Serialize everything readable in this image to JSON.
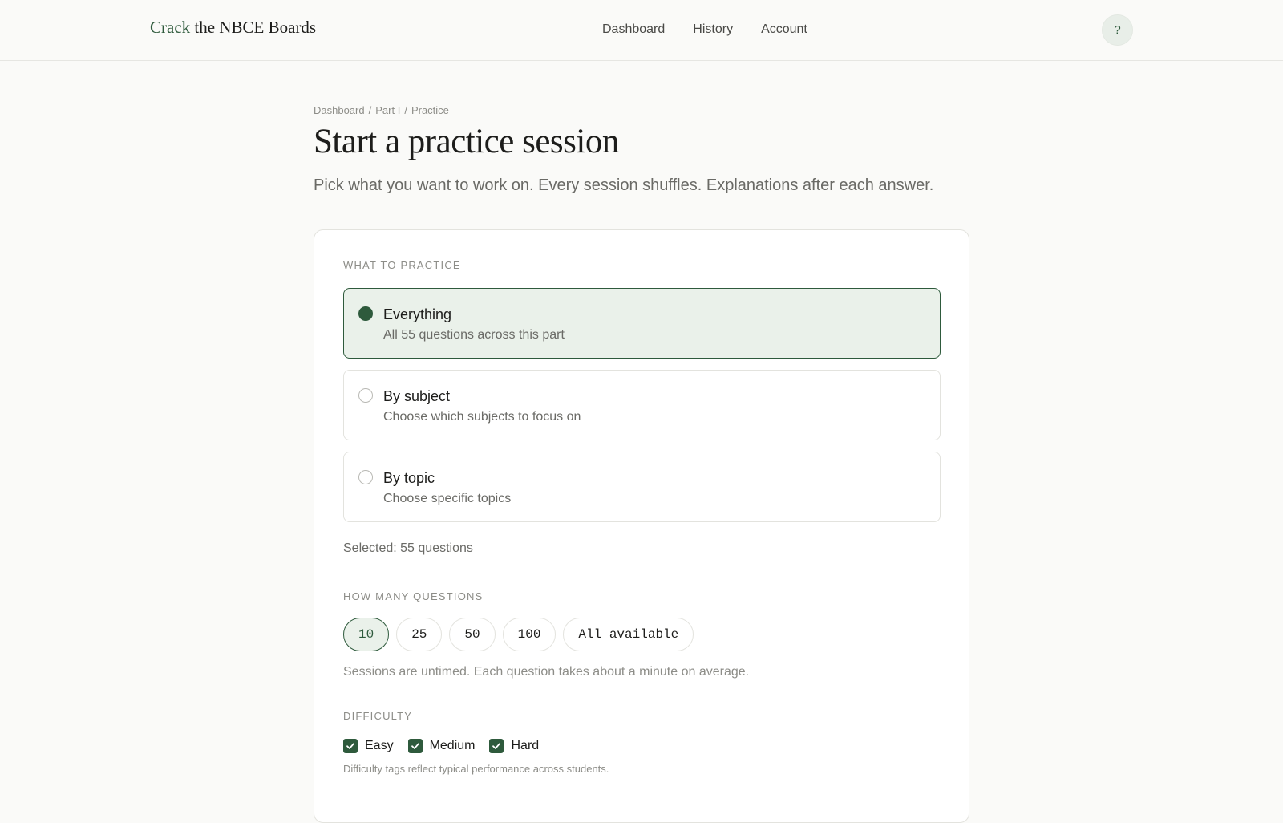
{
  "brand": {
    "accent": "Crack",
    "rest": " the NBCE Boards"
  },
  "nav": {
    "items": [
      "Dashboard",
      "History",
      "Account"
    ]
  },
  "help": {
    "label": "?"
  },
  "breadcrumb": {
    "items": [
      "Dashboard",
      "Part I",
      "Practice"
    ],
    "separator": "/"
  },
  "page": {
    "title": "Start a practice session",
    "subtitle": "Pick what you want to work on. Every session shuffles. Explanations after each answer."
  },
  "practice": {
    "label": "WHAT TO PRACTICE",
    "options": [
      {
        "title": "Everything",
        "desc": "All 55 questions across this part",
        "selected": true
      },
      {
        "title": "By subject",
        "desc": "Choose which subjects to focus on",
        "selected": false
      },
      {
        "title": "By topic",
        "desc": "Choose specific topics",
        "selected": false
      }
    ],
    "selected_text": "Selected: 55 questions"
  },
  "count": {
    "label": "HOW MANY QUESTIONS",
    "options": [
      "10",
      "25",
      "50",
      "100",
      "All available"
    ],
    "selected": "10",
    "hint": "Sessions are untimed. Each question takes about a minute on average."
  },
  "difficulty": {
    "label": "DIFFICULTY",
    "options": [
      {
        "label": "Easy",
        "checked": true
      },
      {
        "label": "Medium",
        "checked": true
      },
      {
        "label": "Hard",
        "checked": true
      }
    ],
    "note": "Difficulty tags reflect typical performance across students."
  },
  "colors": {
    "accent": "#2e5a3c",
    "selected_bg": "#eaf1ea",
    "border": "#e3e3de"
  }
}
